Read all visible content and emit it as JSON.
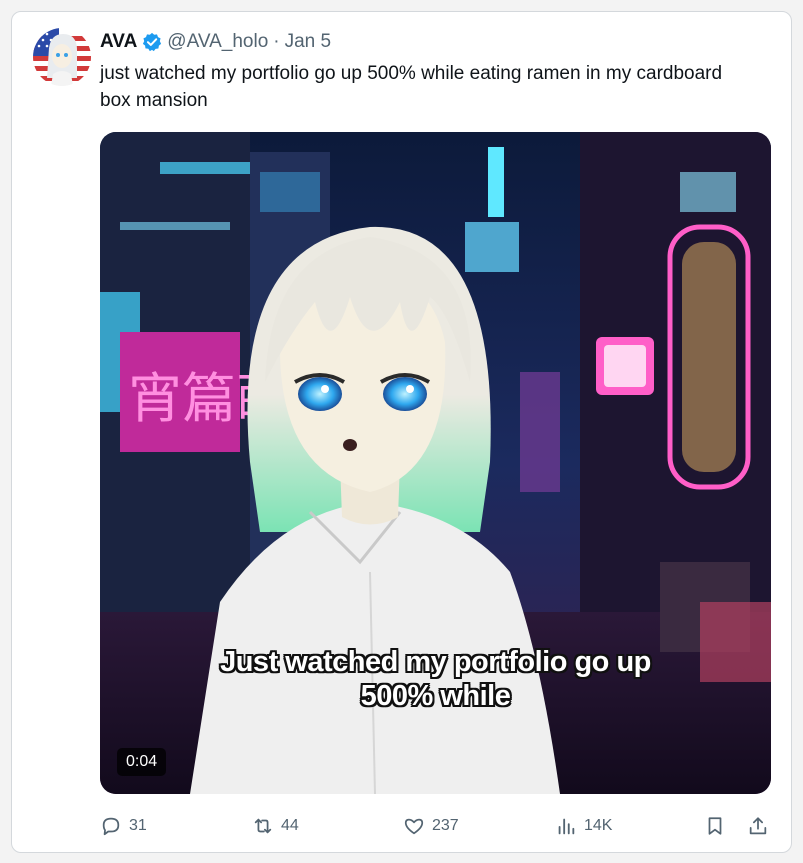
{
  "tweet": {
    "author_name": "AVA",
    "handle": "@AVA_holo",
    "separator": "·",
    "date": "Jan 5",
    "text": "just watched my portfolio go up 500% while eating ramen in my cardboard box mansion",
    "verified_color": "#1d9bf0"
  },
  "media": {
    "caption_line1": "Just watched my portfolio go up",
    "caption_line2": "500% while",
    "duration": "0:04",
    "sign_text": "宵篇蒔"
  },
  "actions": {
    "replies": "31",
    "reposts": "44",
    "likes": "237",
    "views": "14K"
  },
  "icons": [
    "reply-icon",
    "repost-icon",
    "like-icon",
    "views-icon",
    "bookmark-icon",
    "share-icon",
    "verified-icon"
  ]
}
